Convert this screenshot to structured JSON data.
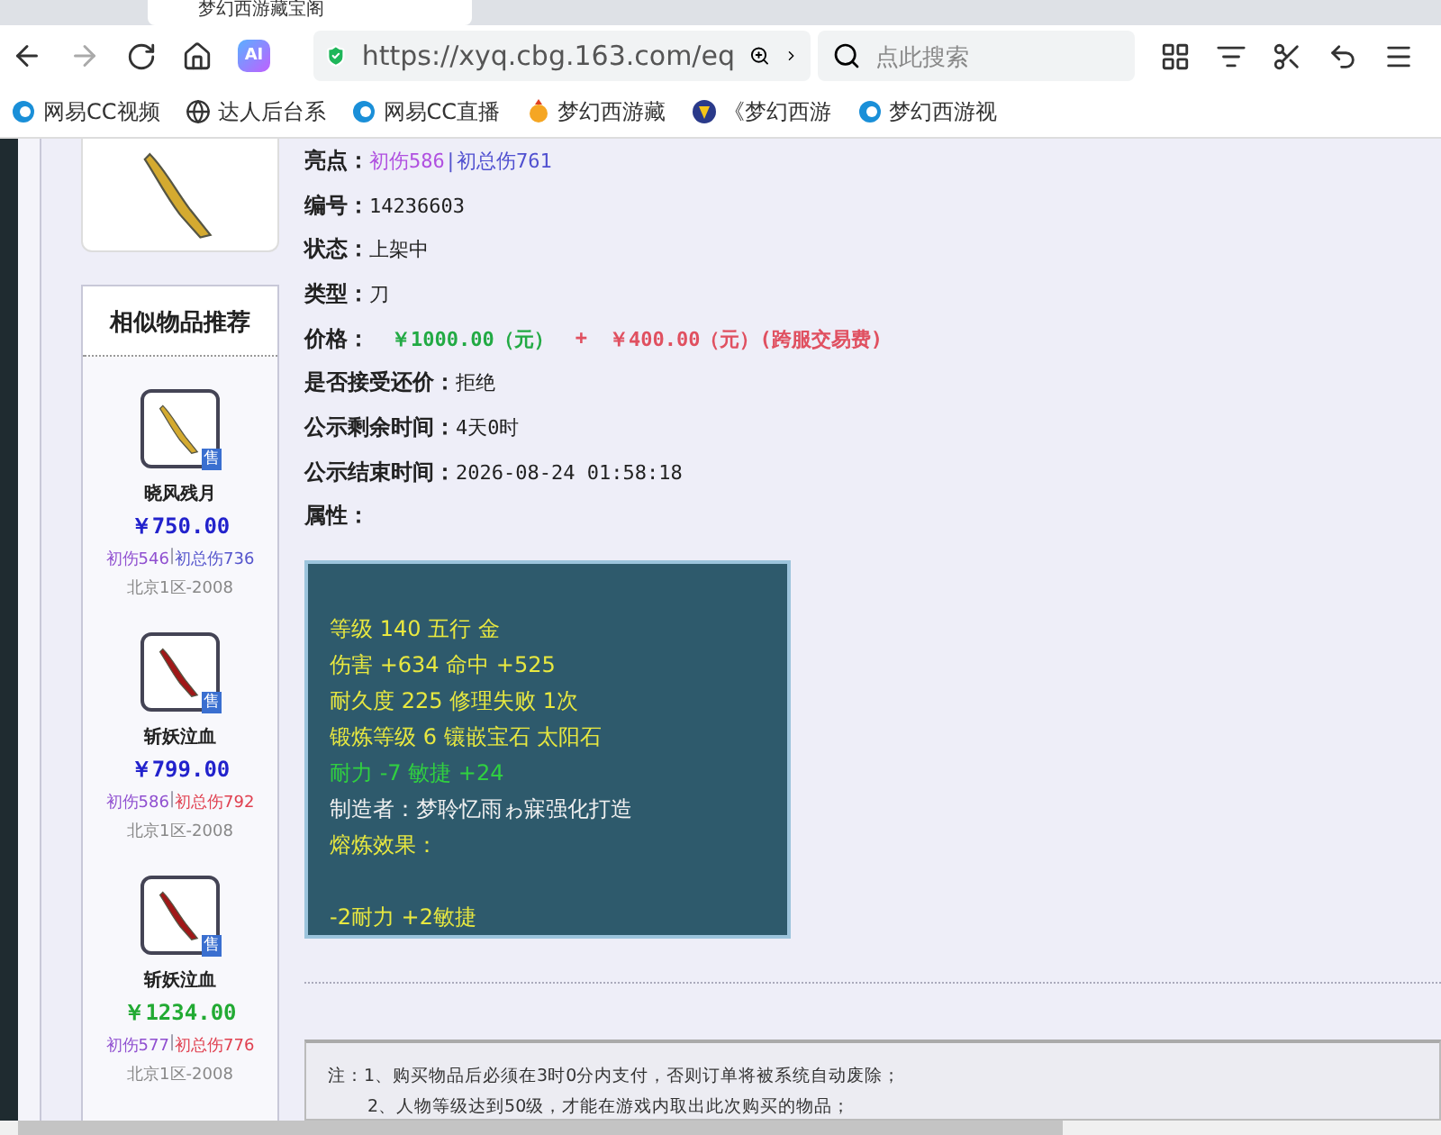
{
  "browser": {
    "tabs": [
      {
        "title": "梦幻西游藏宝阁",
        "selected": true
      }
    ],
    "address": "https://xyq.cbg.163.com/eq",
    "search": {
      "placeholder": "点此搜索"
    },
    "ai_label": "AI",
    "bookmarks": [
      {
        "label": "网易CC视频",
        "kind": "cc"
      },
      {
        "label": "达人后台系",
        "kind": "globe"
      },
      {
        "label": "网易CC直播",
        "kind": "cc"
      },
      {
        "label": "梦幻西游藏",
        "kind": "game"
      },
      {
        "label": "《梦幻西游",
        "kind": "badge"
      },
      {
        "label": "梦幻西游视",
        "kind": "cc"
      }
    ]
  },
  "sidebar": {
    "title": "相似物品推荐",
    "items": [
      {
        "name": "晓风残月",
        "kind": "gold",
        "price": {
          "text": "￥750.00",
          "color": "#2222cc"
        },
        "damage": "初伤546",
        "separator": "|",
        "total": {
          "text": "初总伤736",
          "color": "#5555cc"
        },
        "server": "北京1区-2008",
        "badge": "售"
      },
      {
        "name": "斩妖泣血",
        "kind": "red",
        "price": {
          "text": "￥799.00",
          "color": "#2222cc"
        },
        "damage": "初伤586",
        "separator": "|",
        "total": {
          "text": "初总伤792",
          "color": "#e04050"
        },
        "server": "北京1区-2008",
        "badge": "售"
      },
      {
        "name": "斩妖泣血",
        "kind": "red",
        "price": {
          "text": "￥1234.00",
          "color": "#22aa33"
        },
        "damage": "初伤577",
        "separator": "|",
        "total": {
          "text": "初总伤776",
          "color": "#e04050"
        },
        "server": "北京1区-2008",
        "badge": "售"
      }
    ]
  },
  "details": [
    {
      "label": "亮点：",
      "kind": "highlight",
      "parts": [
        "初伤586",
        "初总伤761"
      ],
      "separator": "|"
    },
    {
      "label": "编号：",
      "kind": "plain",
      "value": "14236603"
    },
    {
      "label": "状态：",
      "kind": "plain",
      "value": "上架中"
    },
    {
      "label": "类型：",
      "kind": "plain",
      "value": "刀"
    },
    {
      "label": "价格：",
      "kind": "price",
      "price": "￥1000.00（元）",
      "plus": "+",
      "fee": "￥400.00（元）(跨服交易费)"
    },
    {
      "label": "是否接受还价：",
      "kind": "plain",
      "value": "拒绝"
    },
    {
      "label": "公示剩余时间：",
      "kind": "plain",
      "value": "4天0时"
    },
    {
      "label": "公示结束时间：",
      "kind": "plain",
      "value": "2026-08-24 01:58:18"
    },
    {
      "label": "属性：",
      "kind": "plain"
    }
  ],
  "attributes": [
    {
      "text": "等级 140 五行 金",
      "kind": "yellow"
    },
    {
      "text": "伤害 +634 命中 +525",
      "kind": "yellow"
    },
    {
      "text": "耐久度 225 修理失败 1次",
      "kind": "yellow"
    },
    {
      "text": "锻炼等级 6 镶嵌宝石 太阳石",
      "kind": "yellow"
    },
    {
      "text": "耐力 -7 敏捷 +24",
      "kind": "green"
    },
    {
      "text": "制造者：梦聆忆雨ゎ寐强化打造",
      "kind": "white"
    },
    {
      "text": "熔炼效果：",
      "kind": "yellow"
    },
    {
      "text": "-2耐力 +2敏捷",
      "kind": "yellow",
      "gap_before": true
    }
  ],
  "notes": [
    "注：1、购买物品后必须在3时0分内支付，否则订单将被系统自动废除；",
    "2、人物等级达到50级，才能在游戏内取出此次购买的物品；"
  ]
}
